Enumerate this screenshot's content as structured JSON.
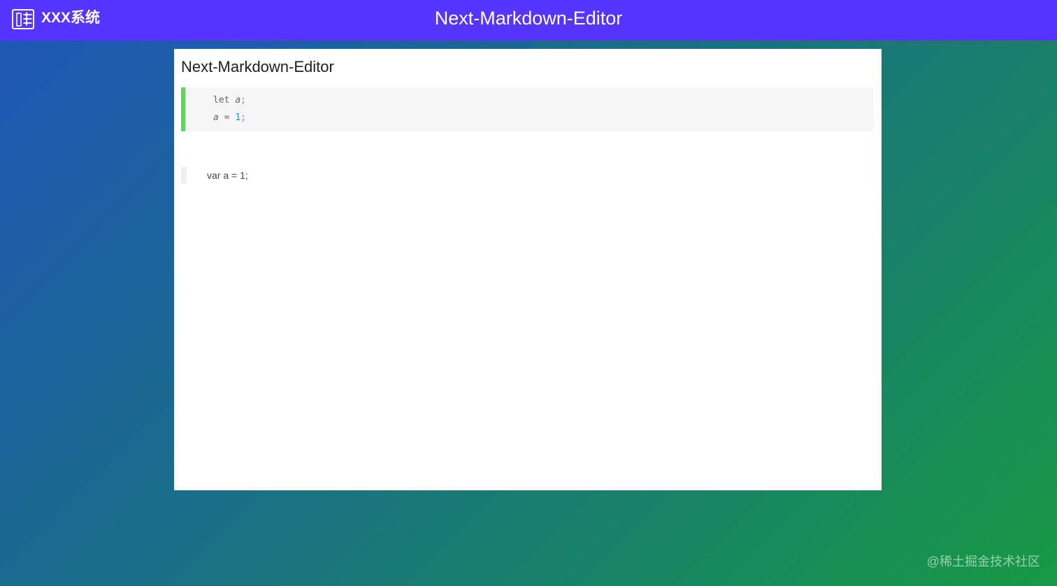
{
  "app": {
    "system_name": "XXX系统",
    "header_title": "Next-Markdown-Editor"
  },
  "editor": {
    "document_title": "Next-Markdown-Editor",
    "code_block": {
      "line_1": {
        "keyword": "let",
        "variable": "a",
        "semicolon": ";"
      },
      "line_2": {
        "variable": "a",
        "operator": "=",
        "number": "1",
        "semicolon": ";"
      }
    },
    "quote_text": "var a = 1;"
  },
  "watermark": "@稀土掘金技术社区",
  "colors": {
    "topbar": "#5535ff",
    "code_accent": "#5fd65f",
    "number": "#1f9aa8",
    "background_start": "#1f55b8",
    "background_end": "#179944"
  },
  "icons": {
    "logo": "app-logo-icon"
  }
}
